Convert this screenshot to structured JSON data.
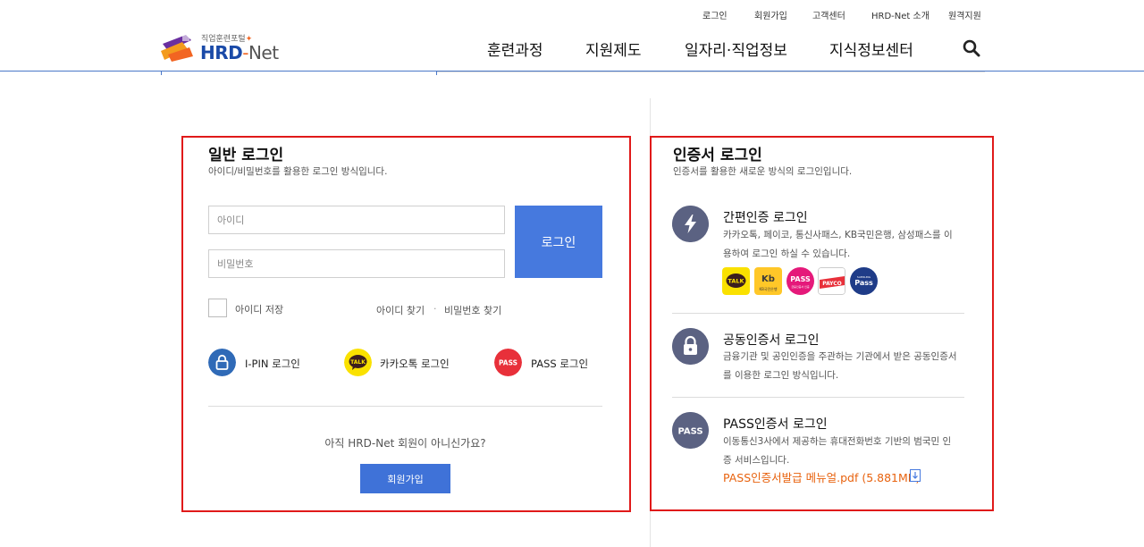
{
  "utility_nav": [
    "로그인",
    "회원가입",
    "고객센터",
    "HRD-Net 소개",
    "원격지원"
  ],
  "logo": {
    "portal_text": "직업훈련포털",
    "brand_main": "HRD",
    "brand_dash": "-",
    "brand_net": "Net"
  },
  "main_nav": [
    "훈련과정",
    "지원제도",
    "일자리·직업정보",
    "지식정보센터"
  ],
  "general_login": {
    "title": "일반 로그인",
    "description": "아이디/비밀번호를 활용한 로그인 방식입니다.",
    "id_placeholder": "아이디",
    "password_placeholder": "비밀번호",
    "login_button": "로그인",
    "save_id_label": "아이디 저장",
    "find_id": "아이디 찾기",
    "find_separator": "·",
    "find_password": "비밀번호 찾기",
    "alt_logins": [
      {
        "label": "I-PIN 로그인",
        "icon": "lock-icon"
      },
      {
        "label": "카카오톡 로그인",
        "icon": "kakaotalk-icon",
        "icon_text": "TALK"
      },
      {
        "label": "PASS 로그인",
        "icon": "pass-icon",
        "icon_text": "PASS"
      }
    ],
    "join_question": "아직 HRD-Net 회원이 아니신가요?",
    "join_button": "회원가입"
  },
  "cert_login": {
    "title": "인증서 로그인",
    "description": "인증서를 활용한 새로운 방식의 로그인입니다.",
    "methods": [
      {
        "title": "간편인증 로그인",
        "description": "카카오톡, 페이코, 통신사패스, KB국민은행, 삼성패스를 이용하여 로그인 하실 수 있습니다.",
        "icon": "lightning-icon"
      },
      {
        "title": "공동인증서 로그인",
        "description": "금융기관 및 공인인증을 주관하는 기관에서 받은 공동인증서를 이용한 로그인 방식입니다.",
        "icon": "lock-icon"
      },
      {
        "title": "PASS인증서 로그인",
        "description": "이동통신3사에서 제공하는 휴대전화번호 기반의 범국민 인증 서비스입니다.",
        "icon": "pass-icon",
        "icon_text": "PASS",
        "manual_link": "PASS인증서발급 메뉴얼.pdf (5.881MB)"
      }
    ],
    "providers": [
      {
        "name": "kakaotalk-icon",
        "text": "TALK"
      },
      {
        "name": "kb-icon",
        "text": "Kb",
        "subtext": "KB국민은행"
      },
      {
        "name": "pass-icon",
        "text": "PASS",
        "subtext": "금융인증서 인증"
      },
      {
        "name": "payco-icon",
        "text": "PAYCO"
      },
      {
        "name": "samsung-pass-icon",
        "text": "Pass",
        "subtext": "SAMSUNG"
      }
    ]
  },
  "colors": {
    "primary": "#4679de",
    "join": "#3f72d8",
    "highlight_border": "#e01a1a",
    "icon_bg": "#5b6282",
    "link_orange": "#e8620e",
    "ipin": "#2f6ab7",
    "kakao": "#fae100",
    "pass": "#e8303a"
  }
}
